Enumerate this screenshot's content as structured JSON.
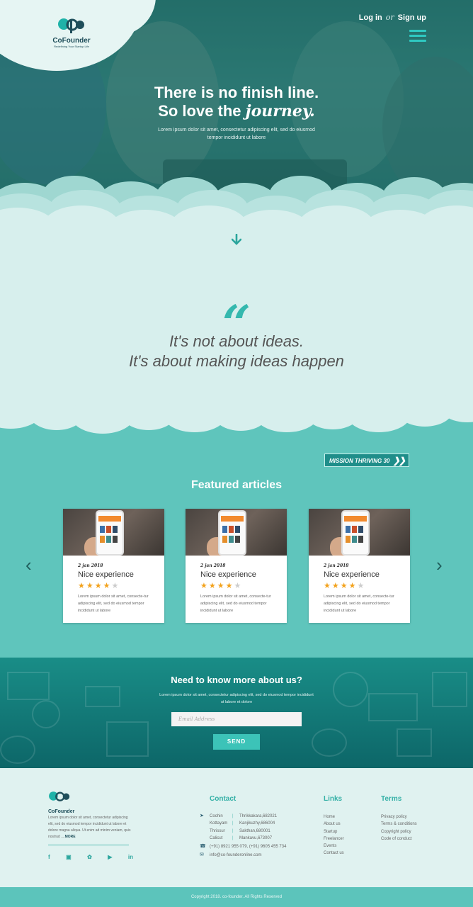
{
  "header": {
    "brand": "CoFounder",
    "brand_tagline": "Redefining Your Startup Life",
    "login": "Log in",
    "or": "or",
    "signup": "Sign up"
  },
  "hero": {
    "line1": "There is no finish line.",
    "line2_prefix": "So love the",
    "line2_accent": "journey.",
    "body": "Lorem ipsum dolor sit amet, consectetur adipiscing elit, sed do eiusmod tempor incididunt ut labore"
  },
  "quote": {
    "mark": "“",
    "line1": "It's not about ideas.",
    "line2": "It's about making ideas happen"
  },
  "featured": {
    "badge": "MISSION THRIVING 30",
    "title": "Featured articles",
    "cards": [
      {
        "date": "2 jan 2018",
        "title": "Nice experience",
        "rating": 4,
        "text": "Lorem ipsum dolor sit amet, consecte-tur adipiscing elit, sed do eiusmod tempor incididunt ut labore"
      },
      {
        "date": "2 jan 2018",
        "title": "Nice experience",
        "rating": 4,
        "text": "Lorem ipsum dolor sit amet, consecte-tur adipiscing elit, sed do eiusmod tempor incididunt ut labore"
      },
      {
        "date": "2 jan 2018",
        "title": "Nice experience",
        "rating": 4,
        "text": "Lorem ipsum dolor sit amet, consecte-tur adipiscing elit, sed do eiusmod tempor incididunt ut labore"
      }
    ]
  },
  "newsletter": {
    "title": "Need to know more about us?",
    "body": "Lorem ipsum dolor sit amet, consectetur adipiscing elit, sed do eiusmod tempor incididunt ut labore et dolore",
    "placeholder": "Email Address",
    "send": "SEND"
  },
  "footer": {
    "brand": "CoFounder",
    "about": "Lorem ipsum dolor sit amet, consectetur adipiscing elit, sed do eiusmod tempor incididunt ut labore et dolore magna aliqua. Ut enim ad minim veniam, quis nostrud ....",
    "more": "MORE",
    "contact_title": "Contact",
    "locations": [
      {
        "city": "Cochin",
        "addr": "Thrikkakara,682021"
      },
      {
        "city": "Kottayam",
        "addr": "Kanjikuzhy,686004"
      },
      {
        "city": "Thrissur",
        "addr": "Sakthan,680001"
      },
      {
        "city": "Calicut",
        "addr": "Mankavu,673007"
      }
    ],
    "phone": "(+91) 8921 955 079, (+91) 9605 455 734",
    "email": "info@co-founderonline.com",
    "links_title": "Links",
    "links": [
      "Home",
      "About us",
      "Startup",
      "Freelancer",
      "Events",
      "Contact us"
    ],
    "terms_title": "Terms",
    "terms": [
      "Privacy policy",
      "Terms & conditions",
      "Copyright policy",
      "Code of conduct"
    ],
    "social": [
      "f",
      "ig",
      "tw",
      "yt",
      "in"
    ],
    "copyright": "Copyright 2018. co-founder. All Rights Reserved"
  },
  "colors": {
    "accent": "#34b8ae",
    "dark_teal": "#0d6668",
    "star": "#f3a21c"
  }
}
